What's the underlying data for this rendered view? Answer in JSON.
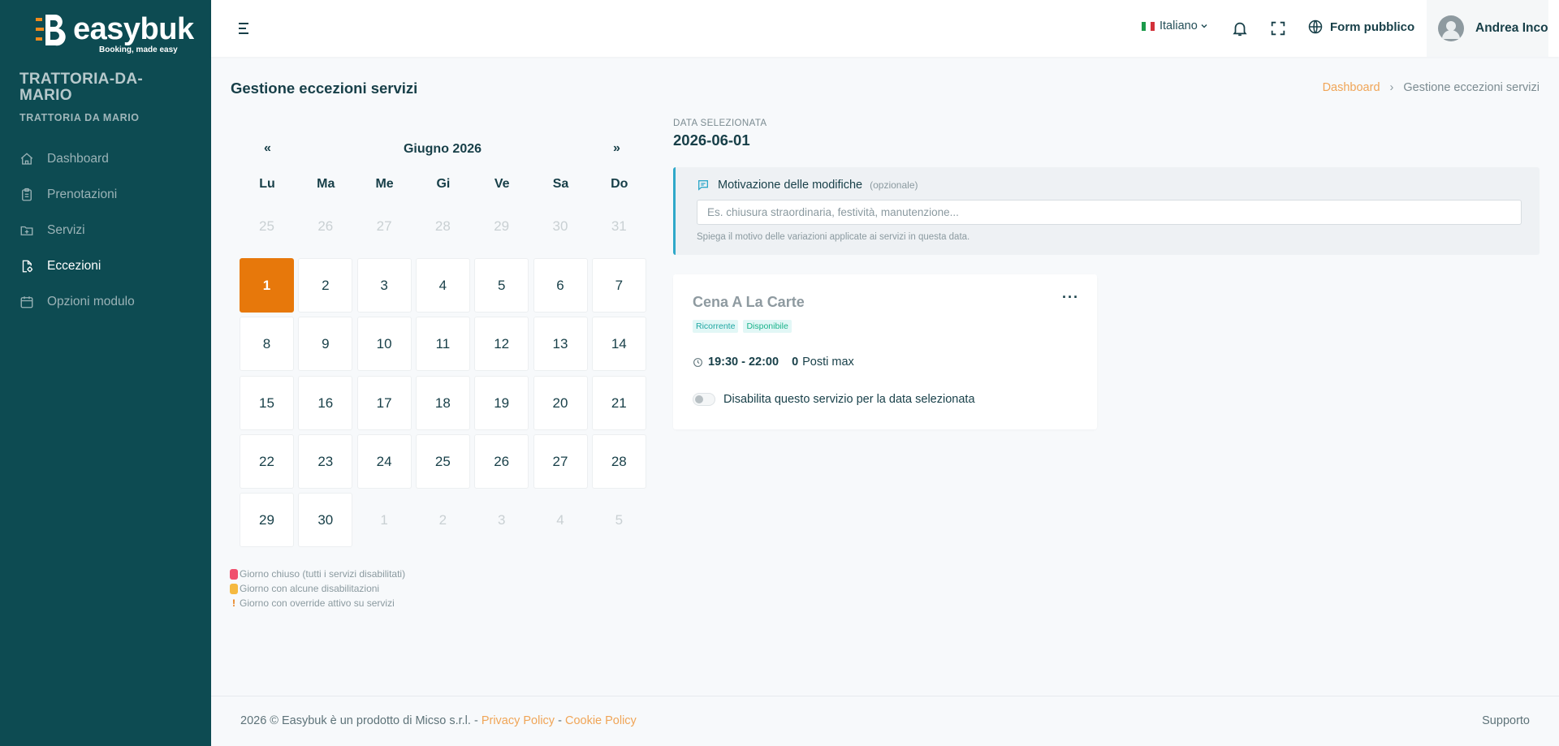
{
  "brand": {
    "name": "easybuk",
    "tagline": "Booking, made easy"
  },
  "org": {
    "title": "TRATTORIA-DA-MARIO",
    "subtitle": "TRATTORIA DA MARIO"
  },
  "sidebar": {
    "items": [
      {
        "label": "Dashboard",
        "icon": "home-icon"
      },
      {
        "label": "Prenotazioni",
        "icon": "clipboard-icon"
      },
      {
        "label": "Servizi",
        "icon": "folder-plus-icon"
      },
      {
        "label": "Eccezioni",
        "icon": "file-settings-icon",
        "active": true
      },
      {
        "label": "Opzioni modulo",
        "icon": "calendar-icon"
      }
    ]
  },
  "topbar": {
    "language": "Italiano",
    "public_form": "Form pubblico",
    "user_name": "Andrea Inco"
  },
  "page": {
    "title": "Gestione eccezioni servizi",
    "breadcrumb": {
      "home": "Dashboard",
      "current": "Gestione eccezioni servizi"
    }
  },
  "calendar": {
    "prev": "«",
    "next": "»",
    "month_label": "Giugno 2026",
    "weekdays": [
      "Lu",
      "Ma",
      "Me",
      "Gi",
      "Ve",
      "Sa",
      "Do"
    ],
    "weeks": [
      [
        [
          "25",
          "other"
        ],
        [
          "26",
          "other"
        ],
        [
          "27",
          "other"
        ],
        [
          "28",
          "other"
        ],
        [
          "29",
          "other"
        ],
        [
          "30",
          "other"
        ],
        [
          "31",
          "other"
        ]
      ],
      [
        [
          "1",
          "sel"
        ],
        [
          "2",
          "cur"
        ],
        [
          "3",
          "cur"
        ],
        [
          "4",
          "cur"
        ],
        [
          "5",
          "cur"
        ],
        [
          "6",
          "cur"
        ],
        [
          "7",
          "cur"
        ]
      ],
      [
        [
          "8",
          "cur"
        ],
        [
          "9",
          "cur"
        ],
        [
          "10",
          "cur"
        ],
        [
          "11",
          "cur"
        ],
        [
          "12",
          "cur"
        ],
        [
          "13",
          "cur"
        ],
        [
          "14",
          "cur"
        ]
      ],
      [
        [
          "15",
          "cur"
        ],
        [
          "16",
          "cur"
        ],
        [
          "17",
          "cur"
        ],
        [
          "18",
          "cur"
        ],
        [
          "19",
          "cur"
        ],
        [
          "20",
          "cur"
        ],
        [
          "21",
          "cur"
        ]
      ],
      [
        [
          "22",
          "cur"
        ],
        [
          "23",
          "cur"
        ],
        [
          "24",
          "cur"
        ],
        [
          "25",
          "cur"
        ],
        [
          "26",
          "cur"
        ],
        [
          "27",
          "cur"
        ],
        [
          "28",
          "cur"
        ]
      ],
      [
        [
          "29",
          "cur"
        ],
        [
          "30",
          "cur"
        ],
        [
          "1",
          "other"
        ],
        [
          "2",
          "other"
        ],
        [
          "3",
          "other"
        ],
        [
          "4",
          "other"
        ],
        [
          "5",
          "other"
        ]
      ]
    ],
    "legend": {
      "closed": "Giorno chiuso (tutti i servizi disabilitati)",
      "partial": "Giorno con alcune disabilitazioni",
      "override": "Giorno con override attivo su servizi",
      "override_mark": "!"
    }
  },
  "selection": {
    "label": "DATA SELEZIONATA",
    "date": "2026-06-01"
  },
  "reason": {
    "title": "Motivazione delle modifiche",
    "optional": "(opzionale)",
    "value": "",
    "placeholder": "Es. chiusura straordinaria, festività, manutenzione...",
    "hint": "Spiega il motivo delle variazioni applicate ai servizi in questa data."
  },
  "service": {
    "name": "Cena A La Carte",
    "badges": [
      "Ricorrente",
      "Disponibile"
    ],
    "time": "19:30 - 22:00",
    "seats": "0",
    "seats_label": "Posti max",
    "more": "···",
    "toggle_label": "Disabilita questo servizio per la data selezionata"
  },
  "footer": {
    "copyright": "2026 © Easybuk è un prodotto di Micso s.r.l. -",
    "privacy": "Privacy Policy",
    "sep": "-",
    "cookie": "Cookie Policy",
    "support": "Supporto"
  },
  "colors": {
    "sidebar_bg": "#0d4b52",
    "accent_orange": "#e7780b",
    "link_orange": "#f0a557",
    "info_blue": "#2fa8c9",
    "legend_red": "#f0506e",
    "legend_yellow": "#f5b940"
  }
}
